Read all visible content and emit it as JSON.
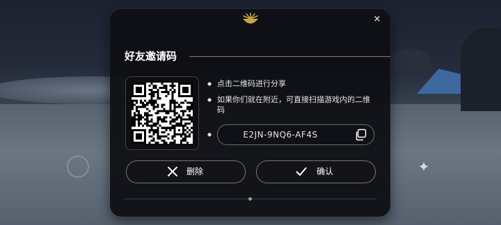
{
  "dialog": {
    "title": "好友邀请码",
    "close_label": "×",
    "tips": [
      "点击二维码进行分享",
      "如果你们就在附近，可直接扫描游戏内的二维码"
    ],
    "bullet_glyph": "◆",
    "invite_code": "E2JN-9NQ6-AF4S",
    "delete_label": "删除",
    "confirm_label": "确认"
  },
  "icons": {
    "close": "close-icon",
    "copy": "copy-icon",
    "delete": "x-icon",
    "confirm": "check-icon",
    "emblem": "sun-fan-emblem-icon",
    "qr": "qr-code",
    "sparkle": "sparkle-icon"
  },
  "colors": {
    "dialog_bg": "#0e0f14",
    "text": "#ffffff",
    "border": "#9a9a9a"
  }
}
